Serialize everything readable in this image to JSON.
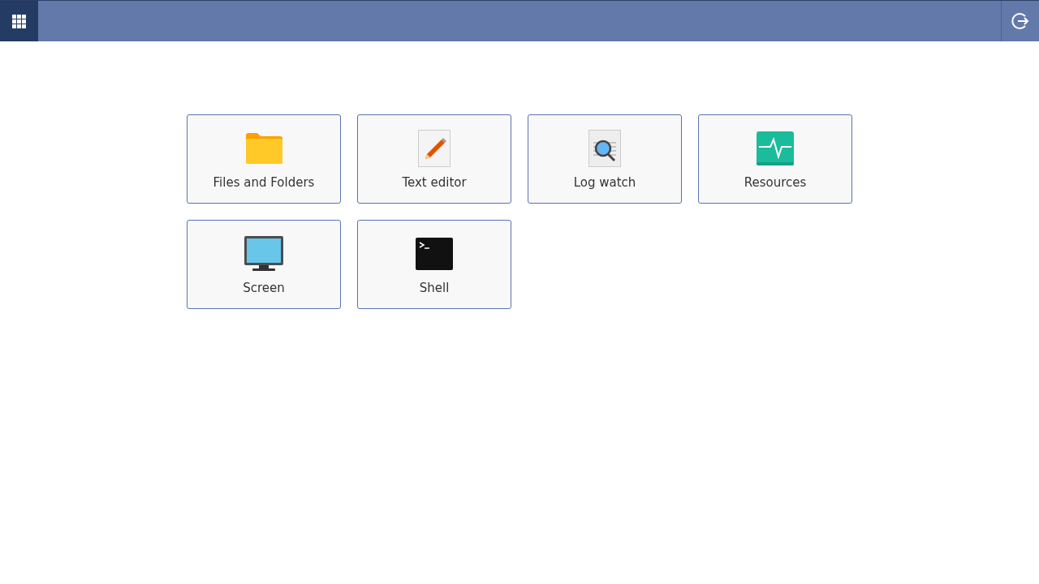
{
  "apps": [
    {
      "kind": "folder",
      "label": "Files and Folders"
    },
    {
      "kind": "editor",
      "label": "Text editor"
    },
    {
      "kind": "log",
      "label": "Log watch"
    },
    {
      "kind": "resources",
      "label": "Resources"
    },
    {
      "kind": "screen",
      "label": "Screen"
    },
    {
      "kind": "shell",
      "label": "Shell"
    }
  ]
}
